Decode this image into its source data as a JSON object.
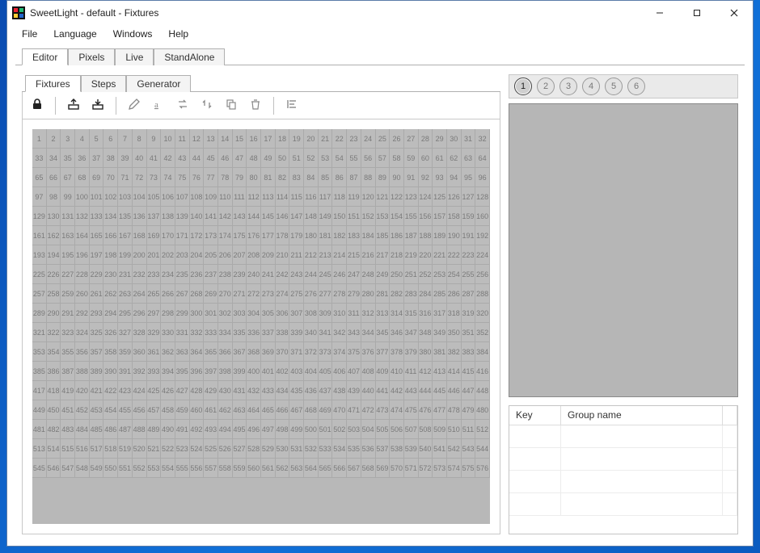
{
  "window": {
    "title": "SweetLight - default - Fixtures"
  },
  "menu": {
    "file": "File",
    "language": "Language",
    "windows": "Windows",
    "help": "Help"
  },
  "top_tabs": {
    "editor": "Editor",
    "pixels": "Pixels",
    "live": "Live",
    "standalone": "StandAlone"
  },
  "sub_tabs": {
    "fixtures": "Fixtures",
    "steps": "Steps",
    "generator": "Generator"
  },
  "toolbar": {
    "lock": "lock",
    "import": "import",
    "export": "export",
    "edit": "edit",
    "rename": "rename",
    "swap": "swap",
    "updown": "updown",
    "copy": "copy",
    "delete": "delete",
    "align": "align"
  },
  "grid": {
    "start": 1,
    "cols": 32,
    "rows": 18
  },
  "pages": {
    "count": 6,
    "active": 1
  },
  "group_table": {
    "headers": {
      "key": "Key",
      "name": "Group name"
    },
    "rows": [
      {
        "key": "",
        "name": ""
      },
      {
        "key": "",
        "name": ""
      },
      {
        "key": "",
        "name": ""
      },
      {
        "key": "",
        "name": ""
      }
    ]
  }
}
